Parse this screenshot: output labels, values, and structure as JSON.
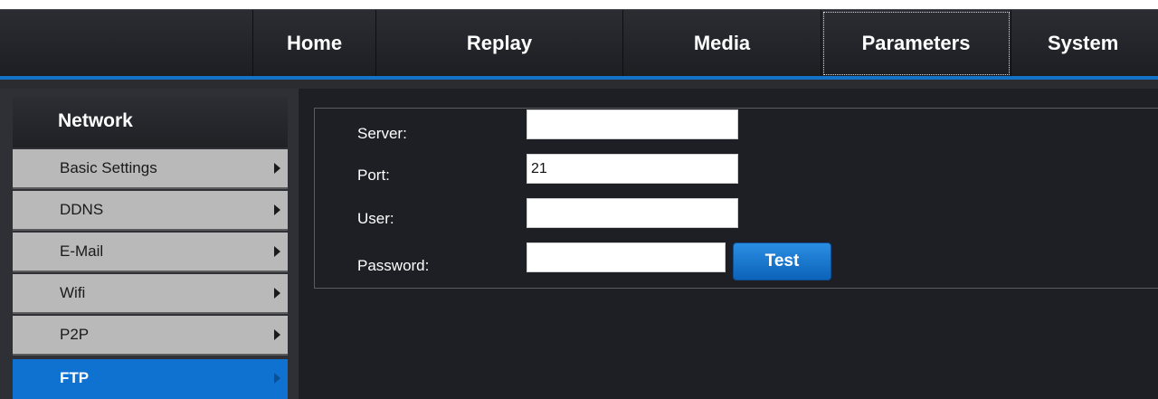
{
  "nav": {
    "items": [
      {
        "label": "Home"
      },
      {
        "label": "Replay"
      },
      {
        "label": "Media"
      },
      {
        "label": "Parameters"
      },
      {
        "label": "System"
      }
    ],
    "selected": "Parameters"
  },
  "sidebar": {
    "title": "Network",
    "items": [
      {
        "label": "Basic Settings"
      },
      {
        "label": "DDNS"
      },
      {
        "label": "E-Mail"
      },
      {
        "label": "Wifi"
      },
      {
        "label": "P2P"
      },
      {
        "label": "FTP"
      }
    ],
    "active": "FTP"
  },
  "form": {
    "server_label": "Server:",
    "server_value": "",
    "port_label": "Port:",
    "port_value": "21",
    "user_label": "User:",
    "user_value": "",
    "password_label": "Password:",
    "password_value": "",
    "test_label": "Test"
  },
  "colors": {
    "accent": "#1473c6",
    "background": "#1d1f24",
    "sidebar_item": "#b9b9b9",
    "active_item": "#0f72d0"
  }
}
